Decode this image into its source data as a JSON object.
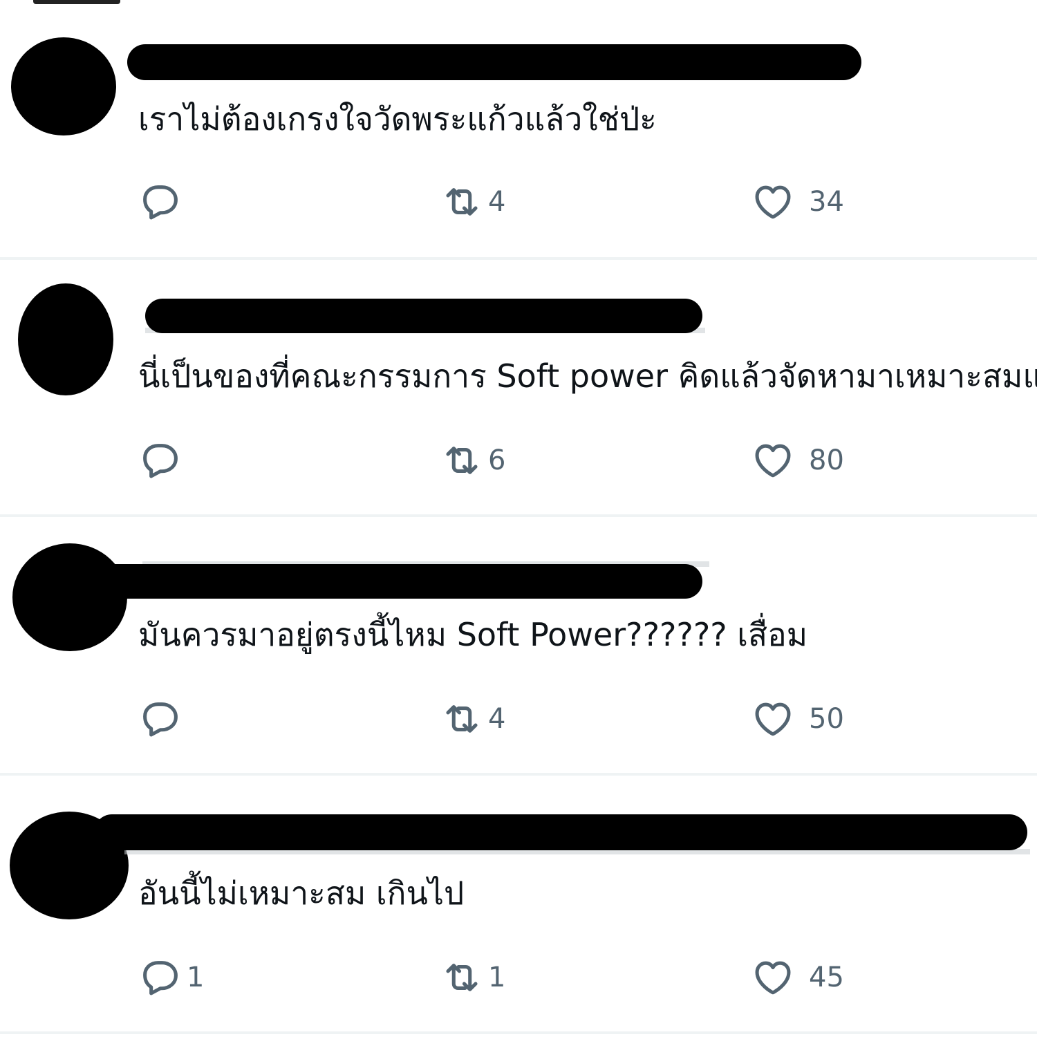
{
  "tweets": [
    {
      "text": "เราไม่ต้องเกรงใจวัดพระแก้วแล้วใช่ป่ะ",
      "replies": "",
      "retweets": "4",
      "likes": "34"
    },
    {
      "text": "นี่เป็นของที่คณะกรรมการ Soft power คิดแล้วจัดหามาเหมาะสมแล้ว",
      "replies": "",
      "retweets": "6",
      "likes": "80"
    },
    {
      "text": "มันควรมาอยู่ตรงนี้ไหม Soft Power?????? เสื่อม",
      "replies": "",
      "retweets": "4",
      "likes": "50"
    },
    {
      "text": "อันนี้ไม่เหมาะสม เกินไป",
      "replies": "1",
      "retweets": "1",
      "likes": "45"
    }
  ],
  "icons": {
    "reply": "reply-icon",
    "retweet": "retweet-icon",
    "like": "heart-icon"
  },
  "colors": {
    "icon": "#536471",
    "text": "#0f1419",
    "divider": "#eff3f4",
    "redaction": "#000000"
  }
}
